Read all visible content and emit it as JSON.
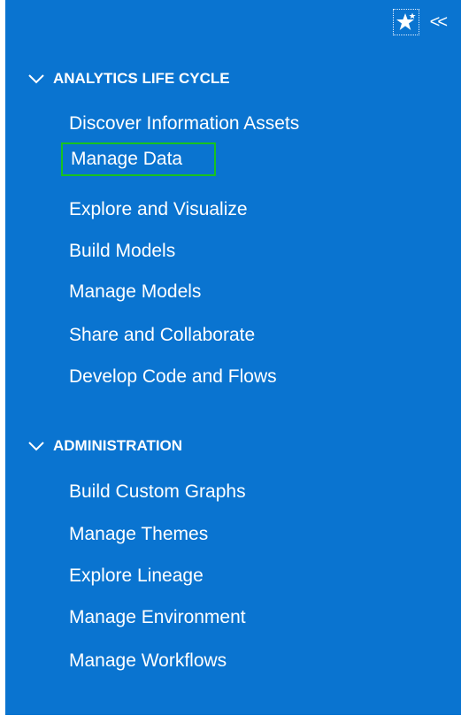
{
  "topbar": {
    "favorites_icon": "star-icon",
    "collapse_label": "<<"
  },
  "sections": [
    {
      "title": "ANALYTICS LIFE CYCLE",
      "items": [
        "Discover Information Assets",
        "Manage Data",
        "Explore and Visualize",
        "Build Models",
        "Manage Models",
        "Share and Collaborate",
        "Develop Code and Flows"
      ]
    },
    {
      "title": "ADMINISTRATION",
      "items": [
        "Build Custom Graphs",
        "Manage Themes",
        "Explore Lineage",
        "Manage Environment",
        "Manage Workflows"
      ]
    }
  ],
  "selected_item": "Manage Data",
  "colors": {
    "panel_bg": "#0a74d0",
    "selected_outline": "#18c21f"
  }
}
